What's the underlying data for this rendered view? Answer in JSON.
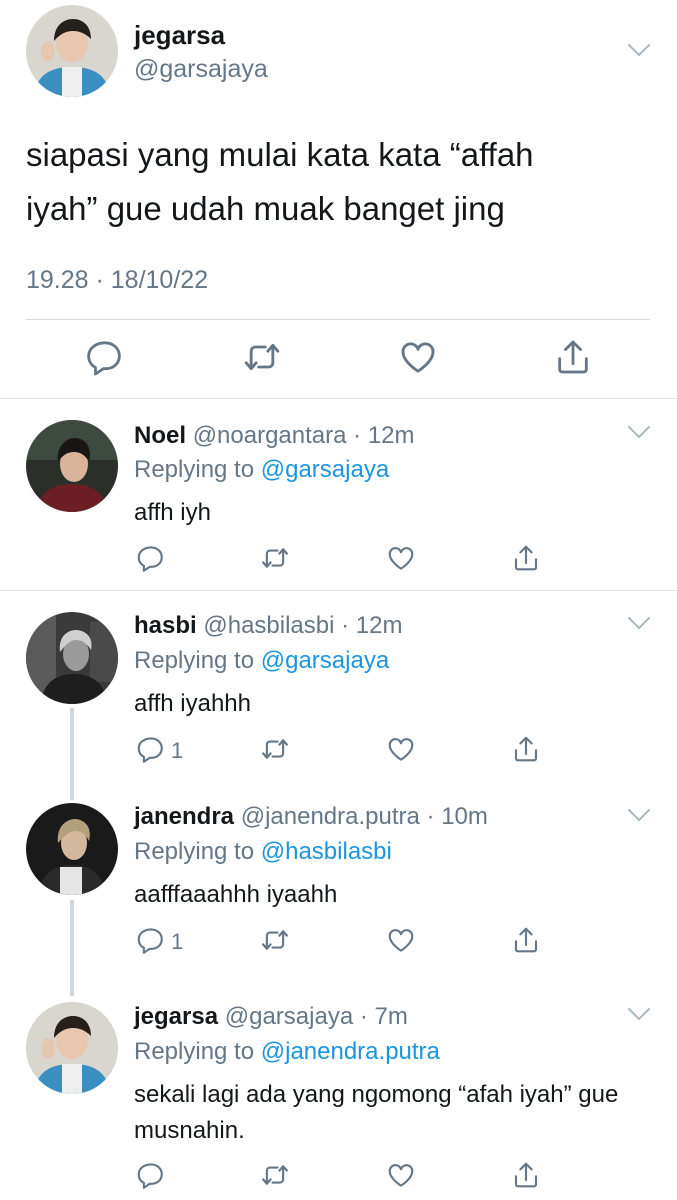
{
  "main_tweet": {
    "name": "jegarsa",
    "handle": "@garsajaya",
    "text_line1": "siapasi yang mulai kata kata “affah",
    "text_line2": "iyah” gue udah muak banget jing",
    "timestamp": "19.28 · 18/10/22"
  },
  "replies": [
    {
      "name": "Noel",
      "handle": "@noargantara",
      "time": "· 12m",
      "replying_label": "Replying to",
      "replying_to": "@garsajaya",
      "text": "affh iyh",
      "reply_count": ""
    },
    {
      "name": "hasbi",
      "handle": "@hasbilasbi",
      "time": "· 12m",
      "replying_label": "Replying to",
      "replying_to": "@garsajaya",
      "text": "affh iyahhh",
      "reply_count": "1"
    },
    {
      "name": "janendra",
      "handle": "@janendra.putra",
      "time": "· 10m",
      "replying_label": "Replying to",
      "replying_to": "@hasbilasbi",
      "text": "aafffaaahhh iyaahh",
      "reply_count": "1"
    },
    {
      "name": "jegarsa",
      "handle": "@garsajaya",
      "time": "· 7m",
      "replying_label": "Replying to",
      "replying_to": "@janendra.putra",
      "text": "sekali lagi ada yang ngomong “afah iyah” gue musnahin.",
      "reply_count": ""
    }
  ],
  "icons": {
    "reply": "reply-icon",
    "retweet": "retweet-icon",
    "like": "heart-icon",
    "share": "share-icon",
    "more": "chevron-down-icon"
  },
  "colors": {
    "link": "#1b95e0",
    "secondary_text": "#657786",
    "primary_text": "#14171a"
  }
}
